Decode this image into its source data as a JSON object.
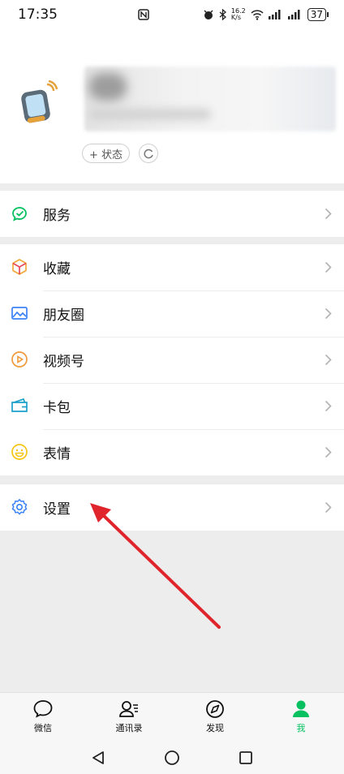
{
  "status_bar": {
    "time": "17:35",
    "net_speed_top": "16.2",
    "net_speed_unit": "K/s",
    "battery": "37"
  },
  "profile": {
    "status_button": "+ 状态"
  },
  "groups": [
    {
      "items": [
        {
          "label": "服务",
          "icon": "wechat-pay-icon",
          "color": "#07c160"
        }
      ]
    },
    {
      "items": [
        {
          "label": "收藏",
          "icon": "favorites-cube-icon",
          "color": "#f2a93b"
        },
        {
          "label": "朋友圈",
          "icon": "moments-photo-icon",
          "color": "#3b82f6"
        },
        {
          "label": "视频号",
          "icon": "channels-play-icon",
          "color": "#f29a3a"
        },
        {
          "label": "卡包",
          "icon": "card-wallet-icon",
          "color": "#1aa0c9"
        },
        {
          "label": "表情",
          "icon": "emoji-smile-icon",
          "color": "#f5c518"
        }
      ]
    },
    {
      "items": [
        {
          "label": "设置",
          "icon": "gear-icon",
          "color": "#3b82f6"
        }
      ]
    }
  ],
  "tabbar": {
    "tabs": [
      {
        "label": "微信",
        "icon": "chat-bubble-icon"
      },
      {
        "label": "通讯录",
        "icon": "contacts-icon"
      },
      {
        "label": "发现",
        "icon": "compass-icon"
      },
      {
        "label": "我",
        "icon": "person-icon",
        "active": true
      }
    ]
  },
  "colors": {
    "accent": "#07c160",
    "annotation_arrow": "#e0242b",
    "background": "#ededed"
  }
}
